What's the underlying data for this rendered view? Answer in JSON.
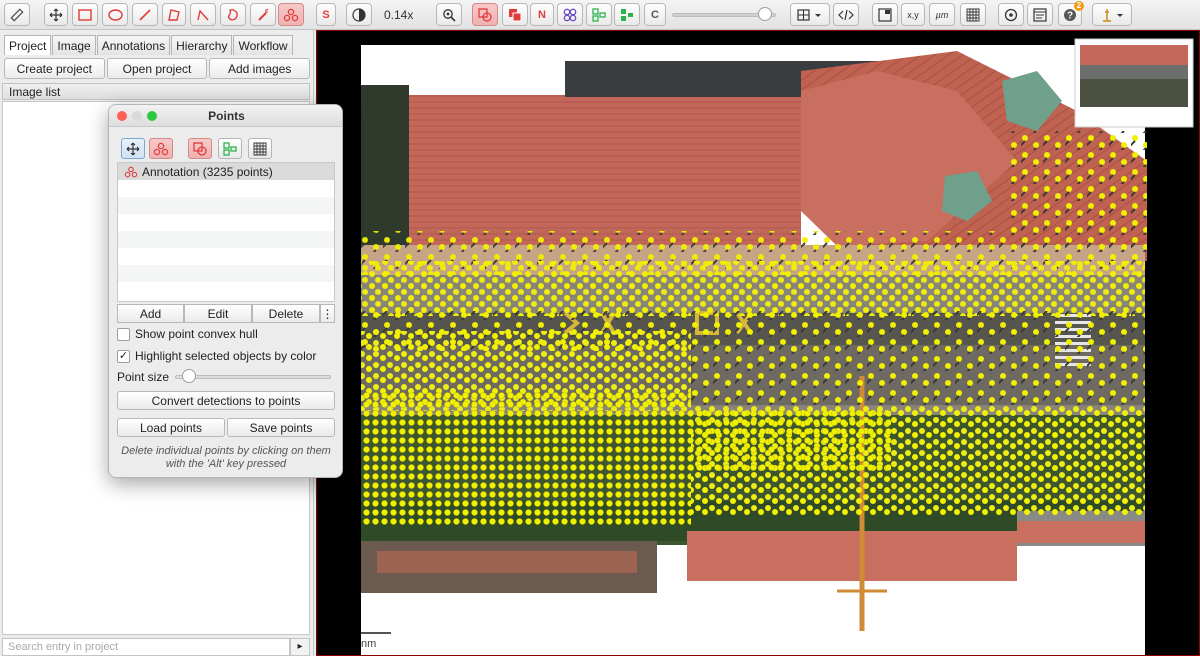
{
  "toolbar": {
    "zoom_level": "0.14x",
    "n_label": "N",
    "s_label": "S",
    "c_label": "C",
    "xy_label": "x,y",
    "um_label": "µm",
    "help_badge": "2",
    "slider_value": 0.95
  },
  "tabs": [
    "Project",
    "Image",
    "Annotations",
    "Hierarchy",
    "Workflow"
  ],
  "project_buttons": {
    "create": "Create project",
    "open": "Open project",
    "add_images": "Add images"
  },
  "image_list": {
    "header": "Image list",
    "search_placeholder": "Search entry in project",
    "search_more": "▸"
  },
  "points_window": {
    "title": "Points",
    "list_items": [
      "Annotation (3235 points)"
    ],
    "buttons": {
      "add": "Add",
      "edit": "Edit",
      "delete": "Delete",
      "more": "⋮"
    },
    "show_convex_hull": {
      "label": "Show point convex hull",
      "checked": false
    },
    "highlight_selected": {
      "label": "Highlight selected objects by color",
      "checked": true
    },
    "point_size_label": "Point size",
    "point_size_value": 0.05,
    "convert_button": "Convert detections to points",
    "load_button": "Load points",
    "save_button": "Save points",
    "hint": "Delete individual points by clicking on them with the 'Alt' key pressed"
  },
  "canvas": {
    "scale_label": "nm"
  },
  "colors": {
    "accent_red": "#e23b3b",
    "point_yellow": "#f2f200",
    "accent_green": "#2bb34a",
    "accent_purple": "#6a4cc7"
  }
}
